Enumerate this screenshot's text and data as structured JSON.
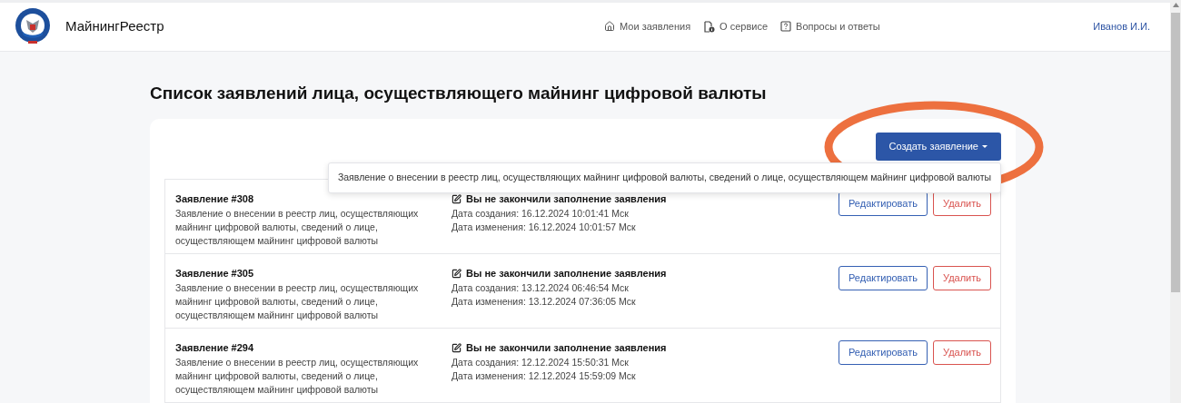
{
  "header": {
    "brand": "МайнингРеестр",
    "nav": [
      {
        "kind": "home",
        "label": "Мои заявления"
      },
      {
        "kind": "info",
        "label": "О сервисе"
      },
      {
        "kind": "help",
        "label": "Вопросы и ответы"
      }
    ],
    "user": "Иванов И.И."
  },
  "page_title": "Список заявлений лица, осуществляющего майнинг цифровой валюты",
  "create_button": {
    "label": "Создать заявление",
    "expanded": true,
    "menu_items": [
      "Заявление о внесении в реестр лиц, осуществляющих майнинг цифровой валюты, сведений о лице, осуществляющем майнинг цифровой валюты"
    ]
  },
  "applications": [
    {
      "title": "Заявление #308",
      "description": "Заявление о внесении в реестр лиц, осуществляющих майнинг цифровой валюты, сведений о лице, осуществляющем майнинг цифровой валюты",
      "status": "Вы не закончили заполнение заявления",
      "created": "Дата создания: 16.12.2024 10:01:41 Мск",
      "modified": "Дата изменения: 16.12.2024 10:01:57 Мск",
      "edit": "Редактировать",
      "delete": "Удалить"
    },
    {
      "title": "Заявление #305",
      "description": "Заявление о внесении в реестр лиц, осуществляющих майнинг цифровой валюты, сведений о лице, осуществляющем майнинг цифровой валюты",
      "status": "Вы не закончили заполнение заявления",
      "created": "Дата создания: 13.12.2024 06:46:54 Мск",
      "modified": "Дата изменения: 13.12.2024 07:36:05 Мск",
      "edit": "Редактировать",
      "delete": "Удалить"
    },
    {
      "title": "Заявление #294",
      "description": "Заявление о внесении в реестр лиц, осуществляющих майнинг цифровой валюты, сведений о лице, осуществляющем майнинг цифровой валюты",
      "status": "Вы не закончили заполнение заявления",
      "created": "Дата создания: 12.12.2024 15:50:31 Мск",
      "modified": "Дата изменения: 12.12.2024 15:59:09 Мск",
      "edit": "Редактировать",
      "delete": "Удалить"
    }
  ]
}
